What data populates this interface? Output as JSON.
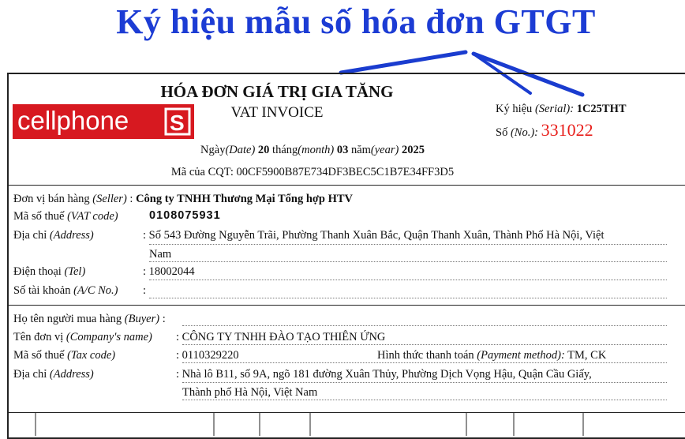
{
  "headline": "Ký hiệu mẫu số hóa đơn GTGT",
  "invoice": {
    "title": "HÓA ĐƠN GIÁ TRỊ GIA TĂNG",
    "subtitle": "VAT INVOICE",
    "logo_text": "cellphone",
    "logo_mark": "S",
    "serial_label": "Ký hiệu",
    "serial_label_en": "(Serial):",
    "serial_value": "1C25THT",
    "number_label": "Số",
    "number_label_en": "(No.):",
    "number_value": "331022",
    "date_day_label": "Ngày",
    "date_day_en": "(Date)",
    "date_day": "20",
    "date_month_label": "tháng",
    "date_month_en": "(month)",
    "date_month": "03",
    "date_year_label": "năm",
    "date_year_en": "(year)",
    "date_year": "2025",
    "cqt_label": "Mã của CQT:",
    "cqt_value": "00CF5900B87E734DF3BEC5C1B7E34FF3D5"
  },
  "seller": {
    "name_label": "Đơn vị bán hàng",
    "name_label_en": "(Seller)",
    "name_value": "Công ty TNHH Thương Mại Tổng hợp HTV",
    "tax_label": "Mã số thuế",
    "tax_label_en": "(VAT code)",
    "tax_value": "0108075931",
    "address_label": "Địa chỉ",
    "address_label_en": "(Address)",
    "address_line1": "Số 543 Đường Nguyễn Trãi, Phường Thanh Xuân Bắc, Quận Thanh Xuân, Thành Phố Hà Nội, Việt",
    "address_line2": "Nam",
    "phone_label": "Điện thoại",
    "phone_label_en": "(Tel)",
    "phone_value": "18002044",
    "account_label": "Số tài khoản",
    "account_label_en": "(A/C No.)"
  },
  "buyer": {
    "buyer_label": "Họ tên người mua hàng",
    "buyer_label_en": "(Buyer)",
    "company_label": "Tên đơn vị",
    "company_label_en": "(Company's name)",
    "company_value": "CÔNG TY TNHH ĐÀO TẠO THIÊN ỨNG",
    "tax_label": "Mã số thuế",
    "tax_label_en": "(Tax code)",
    "tax_value": "0110329220",
    "payment_label": "Hình thức thanh toán",
    "payment_label_en": "(Payment method):",
    "payment_value": "TM, CK",
    "address_label": "Địa chỉ",
    "address_label_en": "(Address)",
    "address_line1": "Nhà lô B11, số 9A, ngõ 181 đường Xuân Thủy, Phường Dịch Vọng Hậu, Quận Cầu Giấy,",
    "address_line2": "Thành phố Hà Nội, Việt Nam"
  },
  "colors": {
    "headline": "#1c3cd4",
    "logo_bg": "#d71920",
    "number": "#e8201c",
    "arrows": "#1a3ccf"
  }
}
